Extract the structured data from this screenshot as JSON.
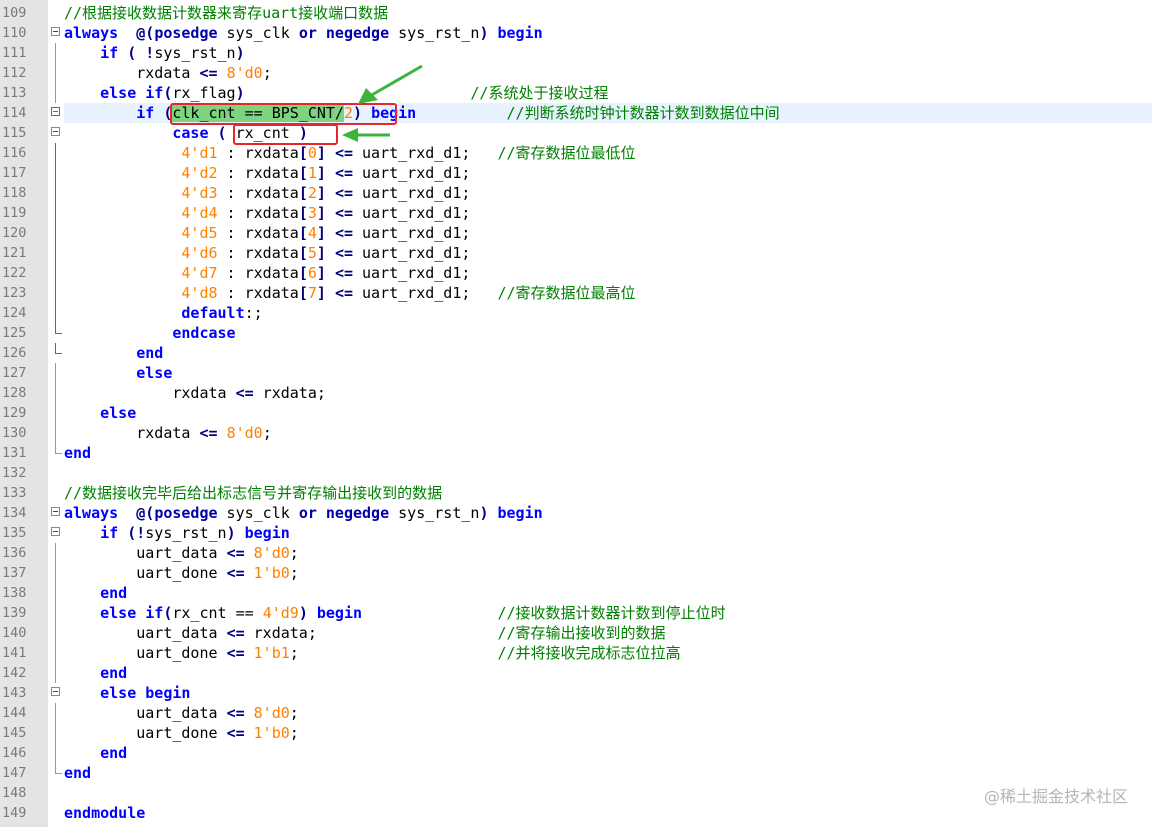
{
  "editor": {
    "lines": [
      {
        "n": "109",
        "fold": "",
        "hl": false,
        "segs": [
          [
            "cm",
            "//根据接收数据计数器来寄存uart接收端口数据"
          ]
        ]
      },
      {
        "n": "110",
        "fold": "open",
        "hl": false,
        "segs": [
          [
            "kw",
            "always"
          ],
          [
            "",
            "  "
          ],
          [
            "pn",
            "@("
          ],
          [
            "k2",
            "posedge"
          ],
          [
            "",
            " sys_clk "
          ],
          [
            "k2",
            "or"
          ],
          [
            "",
            " "
          ],
          [
            "k2",
            "negedge"
          ],
          [
            "",
            " sys_rst_n"
          ],
          [
            "pn",
            ")"
          ],
          [
            "",
            " "
          ],
          [
            "kw",
            "begin"
          ]
        ]
      },
      {
        "n": "111",
        "fold": "line",
        "hl": false,
        "segs": [
          [
            "",
            "    "
          ],
          [
            "kw",
            "if"
          ],
          [
            "",
            " "
          ],
          [
            "pn",
            "("
          ],
          [
            "",
            " "
          ],
          [
            "op",
            "!"
          ],
          [
            "",
            "sys_rst_n"
          ],
          [
            "pn",
            ")"
          ]
        ]
      },
      {
        "n": "112",
        "fold": "line",
        "hl": false,
        "segs": [
          [
            "",
            "        rxdata "
          ],
          [
            "op",
            "<="
          ],
          [
            "",
            " "
          ],
          [
            "num",
            "8'd0"
          ],
          [
            "",
            ";"
          ]
        ]
      },
      {
        "n": "113",
        "fold": "line",
        "hl": false,
        "segs": [
          [
            "",
            "    "
          ],
          [
            "kw",
            "else"
          ],
          [
            "",
            " "
          ],
          [
            "kw",
            "if"
          ],
          [
            "pn",
            "("
          ],
          [
            "",
            "rx_flag"
          ],
          [
            "pn",
            ")"
          ],
          [
            "",
            "                         "
          ],
          [
            "cm",
            "//系统处于接收过程"
          ]
        ]
      },
      {
        "n": "114",
        "fold": "open-red",
        "hl": true,
        "segs": [
          [
            "",
            "        "
          ],
          [
            "kw",
            "if"
          ],
          [
            "",
            " "
          ],
          [
            "pn",
            "("
          ],
          [
            "sel",
            "clk_cnt == BPS_CNT/"
          ],
          [
            "num",
            "2"
          ],
          [
            "pn",
            ")"
          ],
          [
            "",
            " "
          ],
          [
            "kw",
            "begin"
          ],
          [
            "",
            "          "
          ],
          [
            "cm",
            "//判断系统时钟计数器计数到数据位中间"
          ]
        ]
      },
      {
        "n": "115",
        "fold": "open",
        "hl": false,
        "segs": [
          [
            "",
            "            "
          ],
          [
            "kw",
            "case"
          ],
          [
            "",
            " "
          ],
          [
            "pn",
            "("
          ],
          [
            "",
            " rx_cnt "
          ],
          [
            "pn",
            ")"
          ]
        ]
      },
      {
        "n": "116",
        "fold": "line2",
        "hl": false,
        "segs": [
          [
            "",
            "             "
          ],
          [
            "num",
            "4'd1"
          ],
          [
            "",
            " : rxdata"
          ],
          [
            "pn",
            "["
          ],
          [
            "num",
            "0"
          ],
          [
            "pn",
            "]"
          ],
          [
            "",
            " "
          ],
          [
            "op",
            "<="
          ],
          [
            "",
            " uart_rxd_d1;   "
          ],
          [
            "cm",
            "//寄存数据位最低位"
          ]
        ]
      },
      {
        "n": "117",
        "fold": "line2",
        "hl": false,
        "segs": [
          [
            "",
            "             "
          ],
          [
            "num",
            "4'd2"
          ],
          [
            "",
            " : rxdata"
          ],
          [
            "pn",
            "["
          ],
          [
            "num",
            "1"
          ],
          [
            "pn",
            "]"
          ],
          [
            "",
            " "
          ],
          [
            "op",
            "<="
          ],
          [
            "",
            " uart_rxd_d1;"
          ]
        ]
      },
      {
        "n": "118",
        "fold": "line2",
        "hl": false,
        "segs": [
          [
            "",
            "             "
          ],
          [
            "num",
            "4'd3"
          ],
          [
            "",
            " : rxdata"
          ],
          [
            "pn",
            "["
          ],
          [
            "num",
            "2"
          ],
          [
            "pn",
            "]"
          ],
          [
            "",
            " "
          ],
          [
            "op",
            "<="
          ],
          [
            "",
            " uart_rxd_d1;"
          ]
        ]
      },
      {
        "n": "119",
        "fold": "line2",
        "hl": false,
        "segs": [
          [
            "",
            "             "
          ],
          [
            "num",
            "4'd4"
          ],
          [
            "",
            " : rxdata"
          ],
          [
            "pn",
            "["
          ],
          [
            "num",
            "3"
          ],
          [
            "pn",
            "]"
          ],
          [
            "",
            " "
          ],
          [
            "op",
            "<="
          ],
          [
            "",
            " uart_rxd_d1;"
          ]
        ]
      },
      {
        "n": "120",
        "fold": "line2",
        "hl": false,
        "segs": [
          [
            "",
            "             "
          ],
          [
            "num",
            "4'd5"
          ],
          [
            "",
            " : rxdata"
          ],
          [
            "pn",
            "["
          ],
          [
            "num",
            "4"
          ],
          [
            "pn",
            "]"
          ],
          [
            "",
            " "
          ],
          [
            "op",
            "<="
          ],
          [
            "",
            " uart_rxd_d1;"
          ]
        ]
      },
      {
        "n": "121",
        "fold": "line2",
        "hl": false,
        "segs": [
          [
            "",
            "             "
          ],
          [
            "num",
            "4'd6"
          ],
          [
            "",
            " : rxdata"
          ],
          [
            "pn",
            "["
          ],
          [
            "num",
            "5"
          ],
          [
            "pn",
            "]"
          ],
          [
            "",
            " "
          ],
          [
            "op",
            "<="
          ],
          [
            "",
            " uart_rxd_d1;"
          ]
        ]
      },
      {
        "n": "122",
        "fold": "line2",
        "hl": false,
        "segs": [
          [
            "",
            "             "
          ],
          [
            "num",
            "4'd7"
          ],
          [
            "",
            " : rxdata"
          ],
          [
            "pn",
            "["
          ],
          [
            "num",
            "6"
          ],
          [
            "pn",
            "]"
          ],
          [
            "",
            " "
          ],
          [
            "op",
            "<="
          ],
          [
            "",
            " uart_rxd_d1;"
          ]
        ]
      },
      {
        "n": "123",
        "fold": "line2",
        "hl": false,
        "segs": [
          [
            "",
            "             "
          ],
          [
            "num",
            "4'd8"
          ],
          [
            "",
            " : rxdata"
          ],
          [
            "pn",
            "["
          ],
          [
            "num",
            "7"
          ],
          [
            "pn",
            "]"
          ],
          [
            "",
            " "
          ],
          [
            "op",
            "<="
          ],
          [
            "",
            " uart_rxd_d1;   "
          ],
          [
            "cm",
            "//寄存数据位最高位"
          ]
        ]
      },
      {
        "n": "124",
        "fold": "line2",
        "hl": false,
        "segs": [
          [
            "",
            "             "
          ],
          [
            "kw",
            "default"
          ],
          [
            "",
            ":;"
          ]
        ]
      },
      {
        "n": "125",
        "fold": "end2",
        "hl": false,
        "segs": [
          [
            "",
            "            "
          ],
          [
            "kw",
            "endcase"
          ]
        ]
      },
      {
        "n": "126",
        "fold": "end-red",
        "hl": false,
        "segs": [
          [
            "",
            "        "
          ],
          [
            "kw",
            "end"
          ]
        ]
      },
      {
        "n": "127",
        "fold": "line",
        "hl": false,
        "segs": [
          [
            "",
            "        "
          ],
          [
            "kw",
            "else"
          ]
        ]
      },
      {
        "n": "128",
        "fold": "line",
        "hl": false,
        "segs": [
          [
            "",
            "            rxdata "
          ],
          [
            "op",
            "<="
          ],
          [
            "",
            " rxdata;"
          ]
        ]
      },
      {
        "n": "129",
        "fold": "line",
        "hl": false,
        "segs": [
          [
            "",
            "    "
          ],
          [
            "kw",
            "else"
          ]
        ]
      },
      {
        "n": "130",
        "fold": "line",
        "hl": false,
        "segs": [
          [
            "",
            "        rxdata "
          ],
          [
            "op",
            "<="
          ],
          [
            "",
            " "
          ],
          [
            "num",
            "8'd0"
          ],
          [
            "",
            ";"
          ]
        ]
      },
      {
        "n": "131",
        "fold": "end",
        "hl": false,
        "segs": [
          [
            "kw",
            "end"
          ]
        ]
      },
      {
        "n": "132",
        "fold": "",
        "hl": false,
        "segs": []
      },
      {
        "n": "133",
        "fold": "",
        "hl": false,
        "segs": [
          [
            "cm",
            "//数据接收完毕后给出标志信号并寄存输出接收到的数据"
          ]
        ]
      },
      {
        "n": "134",
        "fold": "open",
        "hl": false,
        "segs": [
          [
            "kw",
            "always"
          ],
          [
            "",
            "  "
          ],
          [
            "pn",
            "@("
          ],
          [
            "k2",
            "posedge"
          ],
          [
            "",
            " sys_clk "
          ],
          [
            "k2",
            "or"
          ],
          [
            "",
            " "
          ],
          [
            "k2",
            "negedge"
          ],
          [
            "",
            " sys_rst_n"
          ],
          [
            "pn",
            ")"
          ],
          [
            "",
            " "
          ],
          [
            "kw",
            "begin"
          ]
        ]
      },
      {
        "n": "135",
        "fold": "open",
        "hl": false,
        "segs": [
          [
            "",
            "    "
          ],
          [
            "kw",
            "if"
          ],
          [
            "",
            " "
          ],
          [
            "pn",
            "("
          ],
          [
            "op",
            "!"
          ],
          [
            "",
            "sys_rst_n"
          ],
          [
            "pn",
            ")"
          ],
          [
            "",
            " "
          ],
          [
            "kw",
            "begin"
          ]
        ]
      },
      {
        "n": "136",
        "fold": "line",
        "hl": false,
        "segs": [
          [
            "",
            "        uart_data "
          ],
          [
            "op",
            "<="
          ],
          [
            "",
            " "
          ],
          [
            "num",
            "8'd0"
          ],
          [
            "",
            ";"
          ]
        ]
      },
      {
        "n": "137",
        "fold": "line",
        "hl": false,
        "segs": [
          [
            "",
            "        uart_done "
          ],
          [
            "op",
            "<="
          ],
          [
            "",
            " "
          ],
          [
            "num",
            "1'b0"
          ],
          [
            "",
            ";"
          ]
        ]
      },
      {
        "n": "138",
        "fold": "line",
        "hl": false,
        "segs": [
          [
            "",
            "    "
          ],
          [
            "kw",
            "end"
          ]
        ]
      },
      {
        "n": "139",
        "fold": "line",
        "hl": false,
        "segs": [
          [
            "",
            "    "
          ],
          [
            "kw",
            "else"
          ],
          [
            "",
            " "
          ],
          [
            "kw",
            "if"
          ],
          [
            "pn",
            "("
          ],
          [
            "",
            "rx_cnt == "
          ],
          [
            "num",
            "4'd9"
          ],
          [
            "pn",
            ")"
          ],
          [
            "",
            " "
          ],
          [
            "kw",
            "begin"
          ],
          [
            "",
            "               "
          ],
          [
            "cm",
            "//接收数据计数器计数到停止位时"
          ]
        ]
      },
      {
        "n": "140",
        "fold": "line",
        "hl": false,
        "segs": [
          [
            "",
            "        uart_data "
          ],
          [
            "op",
            "<="
          ],
          [
            "",
            " rxdata;                    "
          ],
          [
            "cm",
            "//寄存输出接收到的数据"
          ]
        ]
      },
      {
        "n": "141",
        "fold": "line",
        "hl": false,
        "segs": [
          [
            "",
            "        uart_done "
          ],
          [
            "op",
            "<="
          ],
          [
            "",
            " "
          ],
          [
            "num",
            "1'b1"
          ],
          [
            "",
            ";                      "
          ],
          [
            "cm",
            "//并将接收完成标志位拉高"
          ]
        ]
      },
      {
        "n": "142",
        "fold": "line",
        "hl": false,
        "segs": [
          [
            "",
            "    "
          ],
          [
            "kw",
            "end"
          ]
        ]
      },
      {
        "n": "143",
        "fold": "open",
        "hl": false,
        "segs": [
          [
            "",
            "    "
          ],
          [
            "kw",
            "else"
          ],
          [
            "",
            " "
          ],
          [
            "kw",
            "begin"
          ]
        ]
      },
      {
        "n": "144",
        "fold": "line",
        "hl": false,
        "segs": [
          [
            "",
            "        uart_data "
          ],
          [
            "op",
            "<="
          ],
          [
            "",
            " "
          ],
          [
            "num",
            "8'd0"
          ],
          [
            "",
            ";"
          ]
        ]
      },
      {
        "n": "145",
        "fold": "line",
        "hl": false,
        "segs": [
          [
            "",
            "        uart_done "
          ],
          [
            "op",
            "<="
          ],
          [
            "",
            " "
          ],
          [
            "num",
            "1'b0"
          ],
          [
            "",
            ";"
          ]
        ]
      },
      {
        "n": "146",
        "fold": "line",
        "hl": false,
        "segs": [
          [
            "",
            "    "
          ],
          [
            "kw",
            "end"
          ]
        ]
      },
      {
        "n": "147",
        "fold": "end",
        "hl": false,
        "segs": [
          [
            "kw",
            "end"
          ]
        ]
      },
      {
        "n": "148",
        "fold": "",
        "hl": false,
        "segs": []
      },
      {
        "n": "149",
        "fold": "",
        "hl": false,
        "segs": [
          [
            "kw",
            "endmodule"
          ]
        ]
      }
    ]
  },
  "watermark": "@稀土掘金技术社区",
  "colors": {
    "keyword": "#0000ff",
    "number": "#ff8000",
    "comment": "#008000",
    "selection": "#7ed47e",
    "annotation_box": "#e8242c",
    "annotation_arrow": "#3cb43c"
  }
}
